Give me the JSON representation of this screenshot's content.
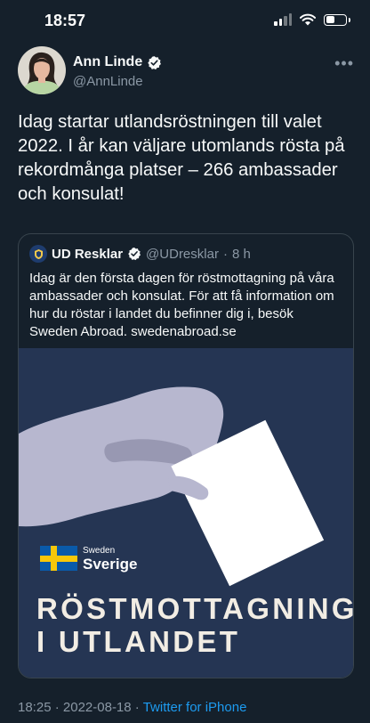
{
  "status_bar": {
    "time": "18:57",
    "battery_level": 0.45
  },
  "tweet": {
    "author_name": "Ann Linde",
    "author_handle": "@AnnLinde",
    "text": "Idag startar utlandsröstningen till valet 2022. I år kan väljare utomlands rösta på rekordmånga platser – 266 ambassader och konsulat!",
    "time": "18:25",
    "separator": "·",
    "date": "2022-08-18",
    "source": "Twitter for iPhone"
  },
  "quoted_tweet": {
    "author_name": "UD Resklar",
    "author_handle": "@UDresklar",
    "dot": "·",
    "age": "8 h",
    "text": "Idag är den första dagen för röstmottagning på våra ambassader och konsulat. För att få information om hur du röstar i landet du befinner dig i, besök Sweden Abroad. swedenabroad.se",
    "media": {
      "logo_small": "Sweden",
      "logo_big": "Sverige",
      "headline_line1": "RÖSTMOTTAGNING",
      "headline_line2": "I UTLANDET"
    }
  },
  "colors": {
    "background": "#15202b",
    "text": "#f7f9f9",
    "secondary_text": "#8b98a5",
    "link": "#1d9bf0",
    "verified": "#f7f9f9",
    "media_background": "#253553"
  },
  "icons": [
    "signal-icon",
    "wifi-icon",
    "battery-icon",
    "verified-icon",
    "more-icon"
  ]
}
